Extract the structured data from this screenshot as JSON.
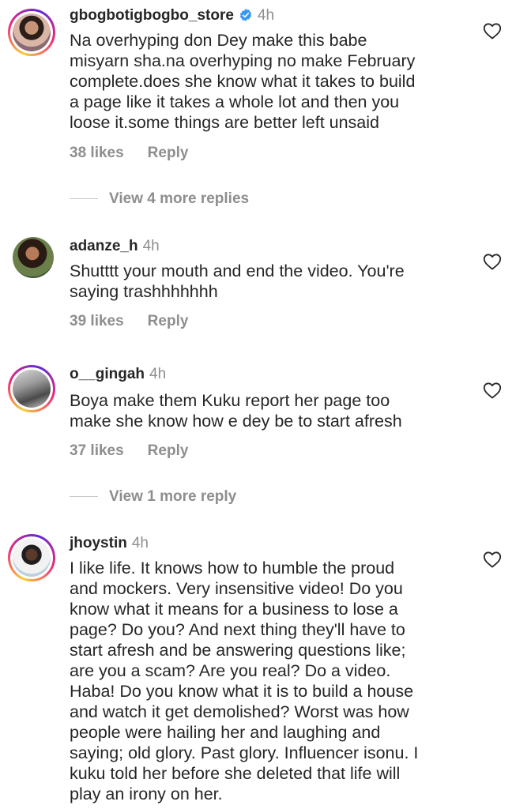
{
  "comments": [
    {
      "username": "gbogbotigbogbo_store",
      "verified": true,
      "time": "4h",
      "lines": [
        "Na overhyping don Dey make this babe",
        "misyarn sha.na overhyping no make February",
        "complete.does she know what it takes to build",
        "a page like it takes a whole lot and then you",
        "loose it.some things are better left unsaid"
      ],
      "likes": "38 likes",
      "reply": "Reply",
      "view_more": "View 4 more replies"
    },
    {
      "username": "adanze_h",
      "verified": false,
      "time": "4h",
      "lines": [
        "Shutttt your mouth and end the video. You're",
        "saying trashhhhhhh"
      ],
      "likes": "39 likes",
      "reply": "Reply"
    },
    {
      "username": "o__gingah",
      "verified": false,
      "time": "4h",
      "lines": [
        "Boya make them Kuku report her page too",
        "make she know how e dey be to start afresh"
      ],
      "likes": "37 likes",
      "reply": "Reply",
      "view_more": "View 1 more reply"
    },
    {
      "username": "jhoystin",
      "verified": false,
      "time": "4h",
      "lines": [
        "I like life. It knows how to humble the proud",
        "and mockers. Very insensitive video! Do you",
        "know what it means for a business to lose a",
        "page? Do you? And next thing they'll have to",
        "start afresh and be answering questions like;",
        "are you a scam? Are you real? Do a video.",
        "Haba! Do you know what it is to build a house",
        "and watch it get demolished? Worst was how",
        "people were hailing her and laughing and",
        "saying; old glory. Past glory. Influencer isonu. I",
        "kuku told her before she deleted that life will",
        "play an irony on her."
      ]
    }
  ],
  "icons": {
    "like": "heart-outline-icon",
    "verified": "verified-badge-icon"
  },
  "colors": {
    "ring_start": "#f9ce34",
    "ring_mid": "#ee2a7b",
    "ring_end": "#6228d7",
    "verified": "#3897f0",
    "muted": "#8e8e8e"
  }
}
